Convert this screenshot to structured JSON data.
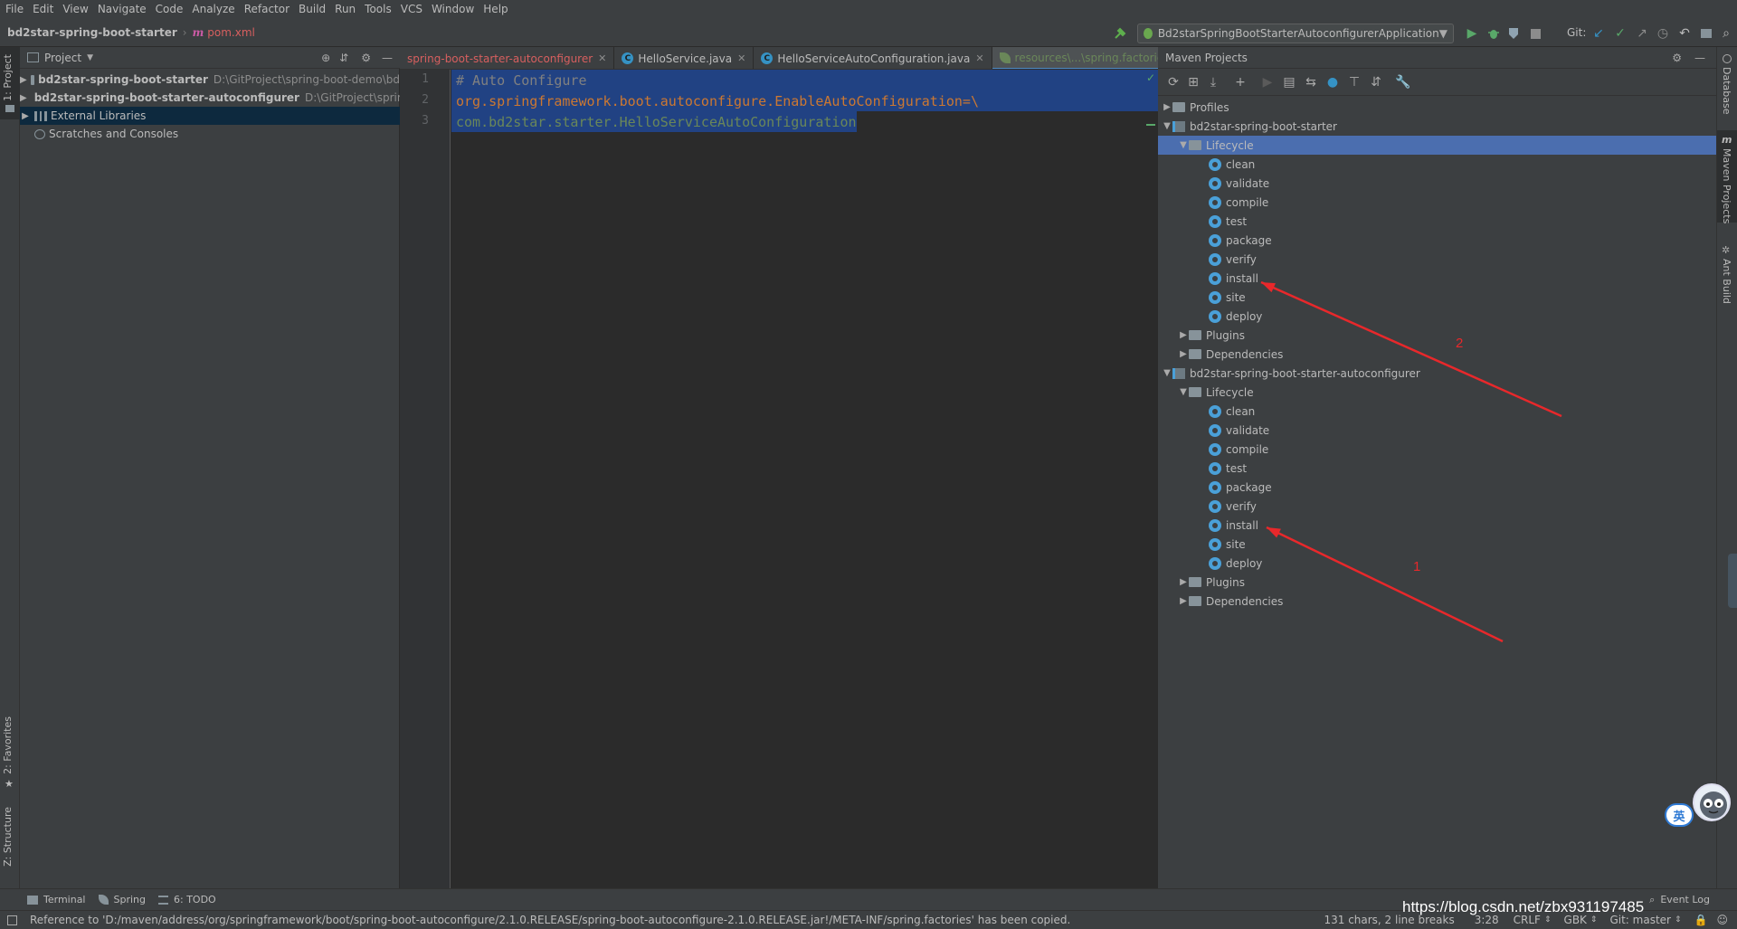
{
  "menu": [
    "File",
    "Edit",
    "View",
    "Navigate",
    "Code",
    "Analyze",
    "Refactor",
    "Build",
    "Run",
    "Tools",
    "VCS",
    "Window",
    "Help"
  ],
  "navbar": {
    "project": "bd2star-spring-boot-starter",
    "file": "pom.xml",
    "file_icon": "m"
  },
  "run_config": {
    "label": "Bd2starSpringBootStarterAutoconfigurerApplication",
    "git_label": "Git:"
  },
  "left_strip": {
    "project_tab": "1: Project",
    "favorites_tab": "2: Favorites",
    "structure_tab": "Z: Structure"
  },
  "project_panel": {
    "title": "Project",
    "rows": [
      {
        "name": "bd2star-spring-boot-starter",
        "path": "D:\\GitProject\\spring-boot-demo\\bd"
      },
      {
        "name": "bd2star-spring-boot-starter-autoconfigurer",
        "path": "D:\\GitProject\\spring"
      },
      {
        "name": "External Libraries",
        "path": ""
      },
      {
        "name": "Scratches and Consoles",
        "path": ""
      }
    ]
  },
  "editor": {
    "tabs": [
      {
        "label": "spring-boot-starter-autoconfigurer",
        "icon": ""
      },
      {
        "label": "HelloService.java",
        "icon": "C"
      },
      {
        "label": "HelloServiceAutoConfiguration.java",
        "icon": "C"
      },
      {
        "label": "resources\\...\\spring.factories",
        "icon": "leaf"
      }
    ],
    "tab_overflow": "4",
    "lines": [
      {
        "num": "1",
        "text": "# Auto Configure"
      },
      {
        "num": "2",
        "text": "org.springframework.boot.autoconfigure.EnableAutoConfiguration=\\"
      },
      {
        "num": "3",
        "text": "com.bd2star.starter.HelloServiceAutoConfiguration"
      }
    ]
  },
  "maven": {
    "title": "Maven Projects",
    "profiles": "Profiles",
    "modules": [
      {
        "name": "bd2star-spring-boot-starter",
        "lifecycle": "Lifecycle",
        "phases": [
          "clean",
          "validate",
          "compile",
          "test",
          "package",
          "verify",
          "install",
          "site",
          "deploy"
        ],
        "plugins": "Plugins",
        "dependencies": "Dependencies"
      },
      {
        "name": "bd2star-spring-boot-starter-autoconfigurer",
        "lifecycle": "Lifecycle",
        "phases": [
          "clean",
          "validate",
          "compile",
          "test",
          "package",
          "verify",
          "install",
          "site",
          "deploy"
        ],
        "plugins": "Plugins",
        "dependencies": "Dependencies"
      }
    ]
  },
  "right_strip": {
    "database": "Database",
    "maven": "Maven Projects",
    "ant": "Ant Build"
  },
  "annotations": {
    "label_1": "1",
    "label_2": "2",
    "arrow_color": "#e8282b"
  },
  "bottom_tools": [
    "Terminal",
    "Spring",
    "6: TODO"
  ],
  "event_log": "Event Log",
  "status": {
    "message": "Reference to 'D:/maven/address/org/springframework/boot/spring-boot-autoconfigure/2.1.0.RELEASE/spring-boot-autoconfigure-2.1.0.RELEASE.jar!/META-INF/spring.factories' has been copied.",
    "chars": "131 chars, 2 line breaks",
    "position": "3:28",
    "line_sep": "CRLF",
    "encoding": "GBK",
    "git": "Git: master"
  },
  "ime": {
    "label": "英"
  },
  "watermark": "https://blog.csdn.net/zbx931197485"
}
